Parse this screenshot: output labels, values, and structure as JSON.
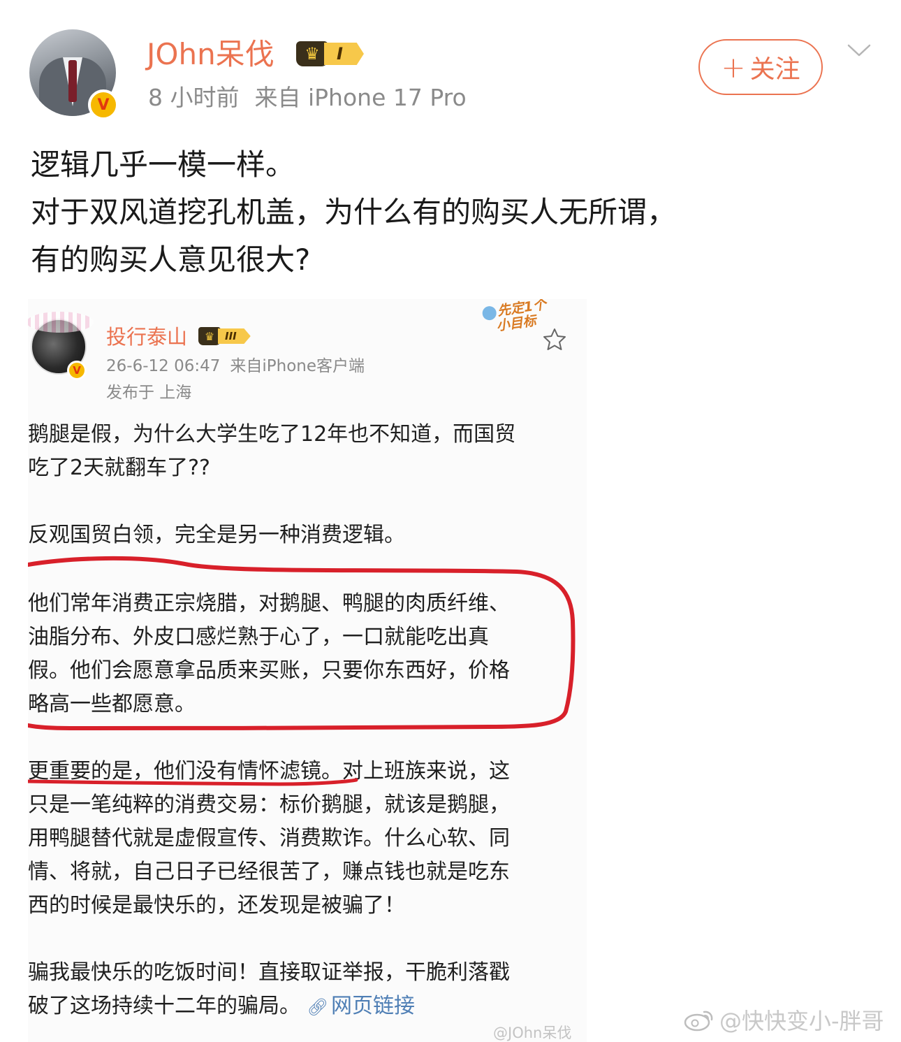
{
  "header": {
    "username": "JOhn呆伐",
    "rank_level": "I",
    "time": "8 小时前",
    "source": "来自 iPhone 17 Pro",
    "follow_label": "关注",
    "follow_plus": "+"
  },
  "post": {
    "lines": [
      "逻辑几乎一模一样。",
      "对于双风道挖孔机盖，为什么有的购买人无所谓，",
      "有的购买人意见很大?"
    ]
  },
  "embedded": {
    "username": "投行泰山",
    "rank_level": "III",
    "timestamp": "26-6-12 06:47",
    "source": "来自iPhone客户端",
    "location": "发布于 上海",
    "sticker_text": "先定1个小目标",
    "body_lines": [
      "鹅腿是假，为什么大学生吃了12年也不知道，而国贸",
      "吃了2天就翻车了??",
      "反观国贸白领，完全是另一种消费逻辑。",
      "他们常年消费正宗烧腊，对鹅腿、鸭腿的肉质纤维、",
      "油脂分布、外皮口感烂熟于心了，一口就能吃出真",
      "假。他们会愿意拿品质来买账，只要你东西好，价格",
      "略高一些都愿意。",
      "更重要的是，他们没有情怀滤镜。对上班族来说，这",
      "只是一笔纯粹的消费交易：标价鹅腿，就该是鹅腿，",
      "用鸭腿替代就是虚假宣传、消费欺诈。什么心软、同",
      "情、将就，自己日子已经很苦了，赚点钱也就是吃东",
      "西的时候是最快乐的，还发现是被骗了！",
      "骗我最快乐的吃饭时间！直接取证举报，干脆利落戳",
      "破了这场持续十二年的骗局。"
    ],
    "link_label": "网页链接",
    "watermark": "@JOhn呆伐"
  },
  "watermark": "@快快变小-胖哥",
  "colors": {
    "accent": "#eb7350",
    "annotation": "#d8202a",
    "meta": "#8a8a8a"
  },
  "icons": [
    "chevron-down-icon",
    "v-verified-icon",
    "crown-icon",
    "star-icon",
    "link-icon",
    "weibo-logo-icon"
  ]
}
